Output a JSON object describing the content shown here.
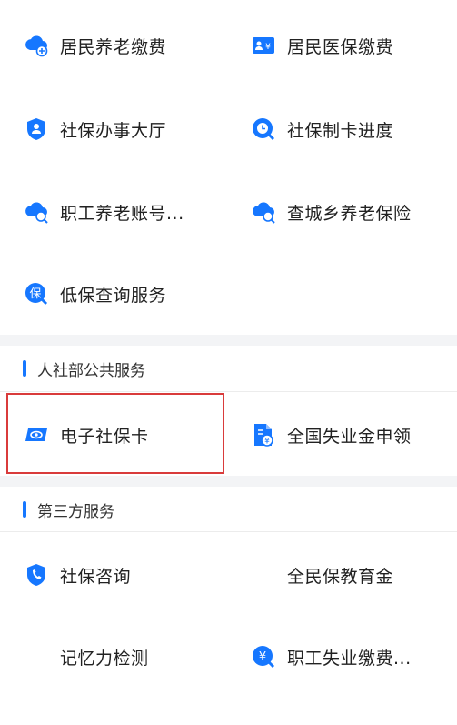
{
  "section1": {
    "items": [
      {
        "label": "居民养老缴费",
        "icon": "cloud-plus-icon"
      },
      {
        "label": "居民医保缴费",
        "icon": "id-card-yuan-icon"
      },
      {
        "label": "社保办事大厅",
        "icon": "shield-person-icon"
      },
      {
        "label": "社保制卡进度",
        "icon": "clock-search-icon"
      },
      {
        "label": "职工养老账号...",
        "icon": "cloud-search-icon"
      },
      {
        "label": "查城乡养老保险",
        "icon": "cloud-search-icon"
      },
      {
        "label": "低保查询服务",
        "icon": "bao-badge-icon"
      }
    ]
  },
  "section2": {
    "title": "人社部公共服务",
    "items": [
      {
        "label": "电子社保卡",
        "icon": "eye-card-icon"
      },
      {
        "label": "全国失业金申领",
        "icon": "document-yuan-icon"
      }
    ]
  },
  "section3": {
    "title": "第三方服务",
    "items": [
      {
        "label": "社保咨询",
        "icon": "shield-phone-icon"
      },
      {
        "label": "全民保教育金",
        "icon": ""
      },
      {
        "label": "记忆力检测",
        "icon": ""
      },
      {
        "label": "职工失业缴费...",
        "icon": "yuan-search-icon"
      }
    ]
  },
  "colors": {
    "accent": "#1677ff",
    "highlight": "#d93b3b",
    "gap": "#f3f4f6"
  }
}
